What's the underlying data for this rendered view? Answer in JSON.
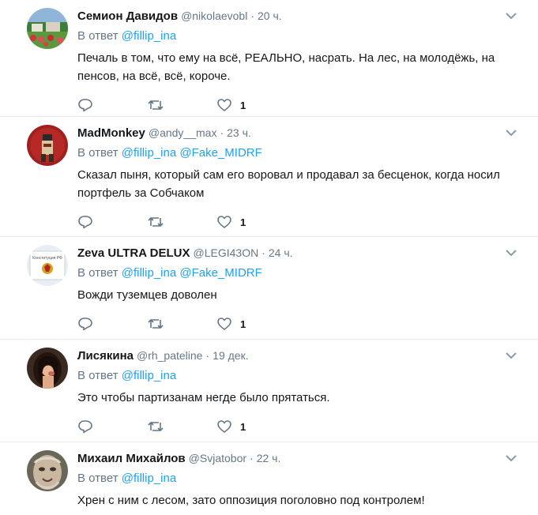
{
  "tweets": [
    {
      "name": "Семион Давидов",
      "handle": "@nikolaevobl",
      "separator": "·",
      "time": "20 ч.",
      "reply_prefix": "В ответ",
      "reply_to": [
        "@fillip_ina"
      ],
      "text": "Печаль в том, что ему на всё, РЕАЛЬНО, насрать. На лес, на молодёжь, на пенсов, на всё, всё, короче.",
      "likes": "1",
      "avatar": "avatar-landscape-flowers"
    },
    {
      "name": "MadMonkey",
      "handle": "@andy__max",
      "separator": "·",
      "time": "23 ч.",
      "reply_prefix": "В ответ",
      "reply_to": [
        "@fillip_ina",
        "@Fake_MIDRF"
      ],
      "text": "Сказал пыня, который сам его воровал и продавал за бесценок, когда носил портфель за Собчаком",
      "likes": "1",
      "avatar": "avatar-red-figure"
    },
    {
      "name": "Zeva ULTRA DELUX",
      "handle": "@LEGI43ON",
      "separator": "·",
      "time": "24 ч.",
      "reply_prefix": "В ответ",
      "reply_to": [
        "@fillip_ina",
        "@Fake_MIDRF"
      ],
      "text": "Вожди туземцев доволен",
      "likes": "1",
      "avatar": "avatar-constitution-book",
      "avatar_text": "Конституция РФ"
    },
    {
      "name": "Лисякина",
      "handle": "@rh_pateline",
      "separator": "·",
      "time": "19 дек.",
      "reply_prefix": "В ответ",
      "reply_to": [
        "@fillip_ina"
      ],
      "text": "Это чтобы партизанам негде было прятаться.",
      "likes": "1",
      "avatar": "avatar-woman-portrait"
    },
    {
      "name": "Михаил Михайлов",
      "handle": "@Svjatobor",
      "separator": "·",
      "time": "22 ч.",
      "reply_prefix": "В ответ",
      "reply_to": [
        "@fillip_ina"
      ],
      "text": "Хрен с ним с лесом, зато оппозиция поголовно под контролем!",
      "likes": "",
      "avatar": "avatar-old-man"
    }
  ],
  "colors": {
    "link": "#1da1f2",
    "muted": "#657786",
    "text": "#14171a",
    "divider": "#e6ecf0"
  }
}
